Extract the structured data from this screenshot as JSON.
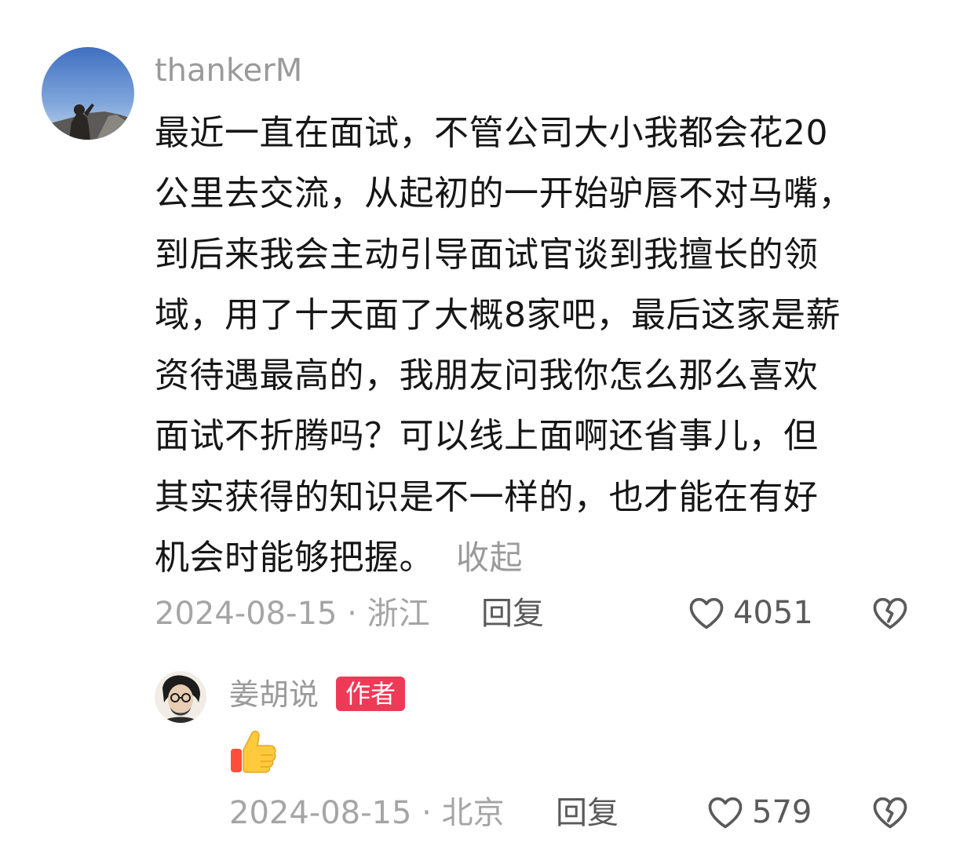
{
  "comment": {
    "username": "thankerM",
    "text_lines": [
      "最近一直在面试，不管公司大小我都会花20",
      "公里去交流，从起初的一开始驴唇不对马嘴，",
      "到后来我会主动引导面试官谈到我擅长的领",
      "域，用了十天面了大概8家吧，最后这家是薪",
      "资待遇最高的，我朋友问我你怎么那么喜欢",
      "面试不折腾吗？可以线上面啊还省事儿，但",
      "其实获得的知识是不一样的，也才能在有好",
      "机会时能够把握。"
    ],
    "collapse_label": "收起",
    "date_location": "2024-08-15 · 浙江",
    "reply_label": "回复",
    "like_count": "4051",
    "like_icon": "heart-outline-icon",
    "dislike_icon": "broken-heart-icon"
  },
  "reply": {
    "username": "姜胡说",
    "badge": "作者",
    "content_emoji": "thumbs-up-emoji",
    "date_location": "2024-08-15 · 北京",
    "reply_label": "回复",
    "like_count": "579"
  },
  "colors": {
    "badge": "#ee3a57",
    "muted_text": "#9a9a9a",
    "body_text": "#161616"
  }
}
